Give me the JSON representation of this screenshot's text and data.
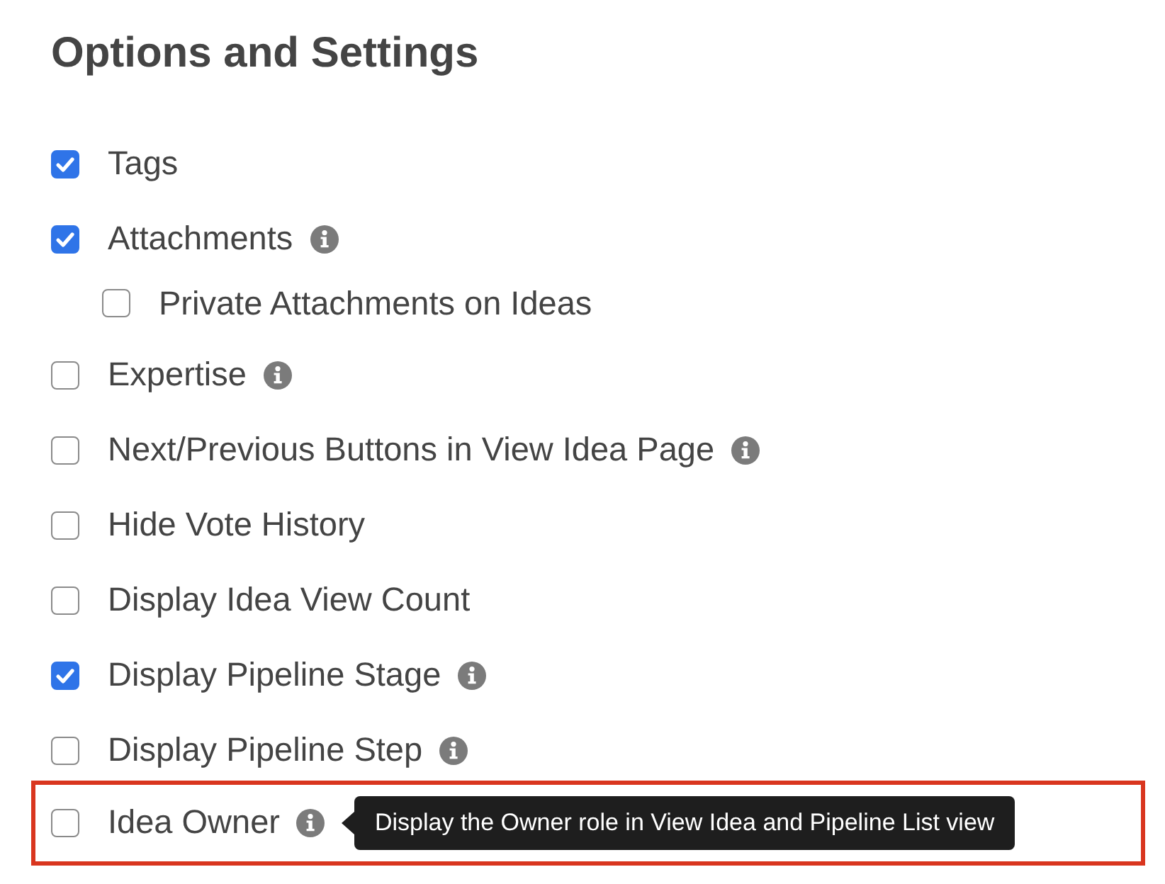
{
  "title": "Options and Settings",
  "options": [
    {
      "label": "Tags",
      "checked": true,
      "info": false
    },
    {
      "label": "Attachments",
      "checked": true,
      "info": true,
      "children": [
        {
          "label": "Private Attachments on Ideas",
          "checked": false,
          "info": false
        }
      ]
    },
    {
      "label": "Expertise",
      "checked": false,
      "info": true
    },
    {
      "label": "Next/Previous Buttons in View Idea Page",
      "checked": false,
      "info": true
    },
    {
      "label": "Hide Vote History",
      "checked": false,
      "info": false
    },
    {
      "label": "Display Idea View Count",
      "checked": false,
      "info": false
    },
    {
      "label": "Display Pipeline Stage",
      "checked": true,
      "info": true
    },
    {
      "label": "Display Pipeline Step",
      "checked": false,
      "info": true
    },
    {
      "label": "Idea Owner",
      "checked": false,
      "info": true,
      "highlighted": true,
      "tooltip": "Display the Owner role in View Idea and Pipeline List view"
    }
  ]
}
